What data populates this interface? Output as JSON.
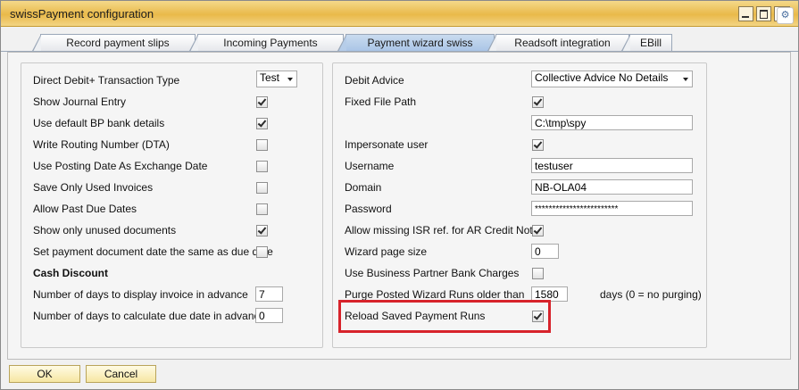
{
  "window": {
    "title": "swissPayment configuration"
  },
  "tabs": [
    {
      "label": "Record payment slips"
    },
    {
      "label": "Incoming Payments"
    },
    {
      "label": "Payment wizard swiss"
    },
    {
      "label": "Readsoft integration"
    },
    {
      "label": "EBill"
    }
  ],
  "left": {
    "direct_debit_label": "Direct Debit+ Transaction Type",
    "direct_debit_value": "Test",
    "show_journal_label": "Show Journal Entry",
    "use_default_bp_label": "Use default BP bank details",
    "write_routing_label": "Write Routing Number (DTA)",
    "use_posting_date_label": "Use Posting Date As Exchange Date",
    "save_only_used_label": "Save Only Used Invoices",
    "allow_past_due_label": "Allow Past Due Dates",
    "show_only_unused_label": "Show only unused documents",
    "set_payment_doc_label": "Set payment document date the same as due date",
    "cash_discount_heading": "Cash Discount",
    "days_display_label": "Number of days to display invoice in advance",
    "days_display_value": "7",
    "days_calc_label": "Number of days to calculate due date in advance",
    "days_calc_value": "0"
  },
  "right": {
    "debit_advice_label": "Debit Advice",
    "debit_advice_value": "Collective Advice No Details",
    "fixed_path_label": "Fixed File Path",
    "fixed_path_value": "C:\\tmp\\spy",
    "impersonate_label": "Impersonate user",
    "username_label": "Username",
    "username_value": "testuser",
    "domain_label": "Domain",
    "domain_value": "NB-OLA04",
    "password_label": "Password",
    "password_value": "************************",
    "allow_missing_isr_label": "Allow missing ISR ref. for AR Credit Notes",
    "wizard_page_size_label": "Wizard page size",
    "wizard_page_size_value": "0",
    "use_bp_charges_label": "Use Business Partner Bank Charges",
    "purge_label": "Purge Posted Wizard Runs older than",
    "purge_value": "1580",
    "purge_suffix": "days (0 = no purging)",
    "reload_label": "Reload Saved Payment Runs"
  },
  "buttons": {
    "ok": "OK",
    "cancel": "Cancel"
  },
  "checkboxes": {
    "show_journal": true,
    "use_default_bp": true,
    "write_routing": false,
    "use_posting_date": false,
    "save_only_used": false,
    "allow_past_due": false,
    "show_only_unused": true,
    "set_payment_doc": false,
    "fixed_path": true,
    "impersonate": true,
    "allow_missing_isr": true,
    "use_bp_charges": false,
    "reload_saved": true
  },
  "colors": {
    "highlight": "#d7232b",
    "title_bar": "#e9b94a",
    "active_tab": "#b6cde9"
  },
  "icons": {
    "settings": "gear-icon"
  }
}
